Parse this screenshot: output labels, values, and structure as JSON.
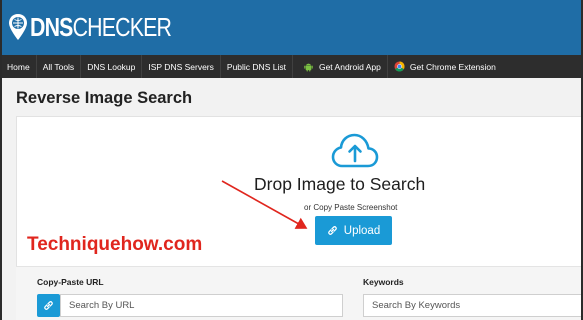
{
  "brand": {
    "logo_text_bold": "DNS",
    "logo_text_rest": "CHECKER",
    "logo_alt": "DNS Checker"
  },
  "colors": {
    "header_bg": "#1f6da6",
    "nav_bg": "#2d2d2d",
    "accent": "#1a9ad6",
    "watermark": "#e0261e"
  },
  "nav": {
    "items": [
      {
        "label": "Home"
      },
      {
        "label": "All Tools"
      },
      {
        "label": "DNS Lookup"
      },
      {
        "label": "ISP DNS Servers"
      },
      {
        "label": "Public DNS List"
      },
      {
        "label": "Get Android App",
        "icon": "android-icon"
      },
      {
        "label": "Get Chrome Extension",
        "icon": "chrome-icon"
      }
    ]
  },
  "page": {
    "title": "Reverse Image Search"
  },
  "dropzone": {
    "icon": "cloud-upload-icon",
    "title": "Drop Image to Search",
    "subtitle": "or Copy Paste Screenshot",
    "upload_label": "Upload"
  },
  "watermark": {
    "text": "Techniquehow.com"
  },
  "url_field": {
    "label": "Copy-Paste URL",
    "placeholder": "Search By URL",
    "value": "",
    "icon": "link-icon"
  },
  "keywords_field": {
    "label": "Keywords",
    "placeholder": "Search By Keywords",
    "value": ""
  }
}
